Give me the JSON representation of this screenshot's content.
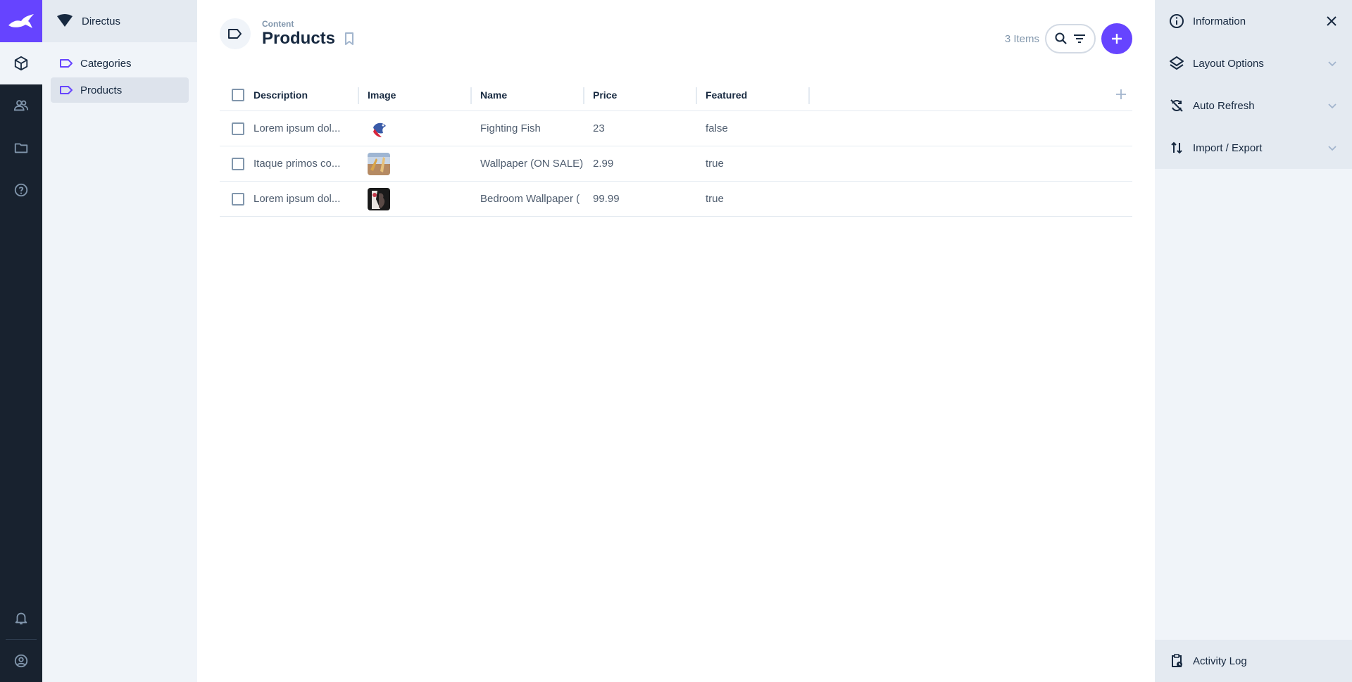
{
  "project": {
    "name": "Directus"
  },
  "colors": {
    "accent": "#6644ff",
    "module_bar": "#18222f",
    "nav_bg": "#f0f4f9"
  },
  "module_bar": {
    "items": [
      {
        "icon": "content-box-icon",
        "active": true
      },
      {
        "icon": "users-icon",
        "active": false
      },
      {
        "icon": "folder-icon",
        "active": false
      },
      {
        "icon": "help-icon",
        "active": false
      }
    ],
    "bottom": [
      {
        "icon": "bell-icon"
      },
      {
        "icon": "account-circle-icon"
      }
    ]
  },
  "navigation": {
    "items": [
      {
        "label": "Categories",
        "icon": "label-icon",
        "active": false
      },
      {
        "label": "Products",
        "icon": "label-icon",
        "active": true
      }
    ]
  },
  "header": {
    "breadcrumb": "Content",
    "title": "Products",
    "items_count": "3 Items"
  },
  "table": {
    "columns": [
      "Description",
      "Image",
      "Name",
      "Price",
      "Featured"
    ],
    "rows": [
      {
        "description": "Lorem ipsum dol...",
        "image": "betta-fish-thumbnail",
        "name": "Fighting Fish",
        "price": "23",
        "featured": "false"
      },
      {
        "description": "Itaque primos co...",
        "image": "wallpaper-thumbnail",
        "name": "Wallpaper (ON SALE)",
        "price": "2.99",
        "featured": "true"
      },
      {
        "description": "Lorem ipsum dol...",
        "image": "bedroom-wallpaper-thumbnail",
        "name": "Bedroom Wallpaper (",
        "price": "99.99",
        "featured": "true"
      }
    ]
  },
  "sidebar": {
    "items": [
      {
        "label": "Information",
        "icon": "info-icon",
        "trailing": "close-icon"
      },
      {
        "label": "Layout Options",
        "icon": "layers-icon",
        "trailing": "chevron-down-icon"
      },
      {
        "label": "Auto Refresh",
        "icon": "sync-disabled-icon",
        "trailing": "chevron-down-icon"
      },
      {
        "label": "Import / Export",
        "icon": "import-export-icon",
        "trailing": "chevron-down-icon"
      }
    ],
    "bottom": {
      "label": "Activity Log",
      "icon": "activity-log-icon"
    }
  }
}
